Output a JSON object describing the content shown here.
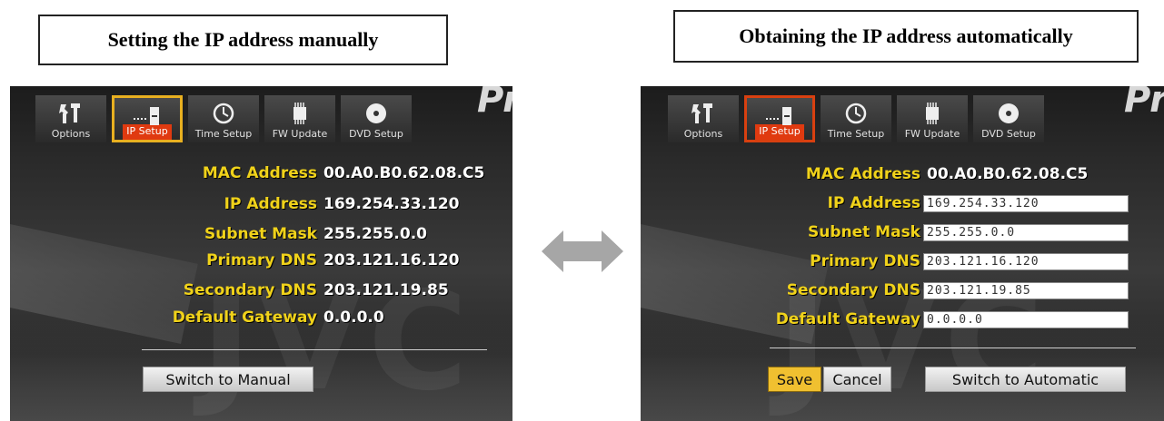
{
  "captions": {
    "left": "Setting the IP address manually",
    "right": "Obtaining the IP address automatically"
  },
  "brand_fragment": "Pr",
  "watermark": "JVC",
  "tabs": [
    {
      "label": "Options",
      "icon": "tools-icon"
    },
    {
      "label": "IP Setup",
      "icon": "network-icon"
    },
    {
      "label": "Time Setup",
      "icon": "clock-icon"
    },
    {
      "label": "FW Update",
      "icon": "chip-icon"
    },
    {
      "label": "DVD Setup",
      "icon": "disc-icon"
    }
  ],
  "fields": {
    "mac_label": "MAC Address",
    "mac_value": "00.A0.B0.62.08.C5",
    "ip_label": "IP Address",
    "ip_value": "169.254.33.120",
    "subnet_label": "Subnet Mask",
    "subnet_value": "255.255.0.0",
    "pdns_label": "Primary DNS",
    "pdns_value": "203.121.16.120",
    "sdns_label": "Secondary DNS",
    "sdns_value": "203.121.19.85",
    "gw_label": "Default Gateway",
    "gw_value": "0.0.0.0"
  },
  "buttons": {
    "switch_manual": "Switch to Manual",
    "save": "Save",
    "cancel": "Cancel",
    "switch_auto": "Switch to Automatic"
  },
  "colors": {
    "label_yellow": "#f0d21a",
    "active_tab_yellow": "#e8b020",
    "active_tab_red": "#d84010",
    "tab_highlight": "#e03a10",
    "save_button": "#f0c030"
  }
}
